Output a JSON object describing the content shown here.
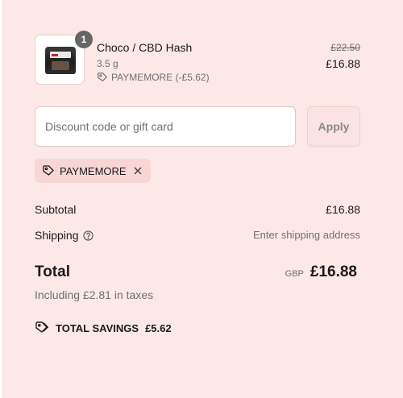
{
  "product": {
    "quantity": "1",
    "name": "Choco / CBD Hash",
    "weight": "3.5 g",
    "discount_label": "PAYMEMORE (-£5.62)",
    "original_price": "£22.50",
    "price": "£16.88"
  },
  "discount": {
    "placeholder": "Discount code or gift card",
    "value": "",
    "apply_label": "Apply",
    "applied_code": "PAYMEMORE"
  },
  "summary": {
    "subtotal_label": "Subtotal",
    "subtotal_value": "£16.88",
    "shipping_label": "Shipping",
    "shipping_value": "Enter shipping address",
    "total_label": "Total",
    "currency": "GBP",
    "total_value": "£16.88",
    "tax_note": "Including £2.81 in taxes",
    "savings_label": "TOTAL SAVINGS",
    "savings_value": "£5.62"
  },
  "colors": {
    "panel_bg": "#fde8e8",
    "chip_bg": "#f9d6d6",
    "muted_text": "#707070"
  }
}
